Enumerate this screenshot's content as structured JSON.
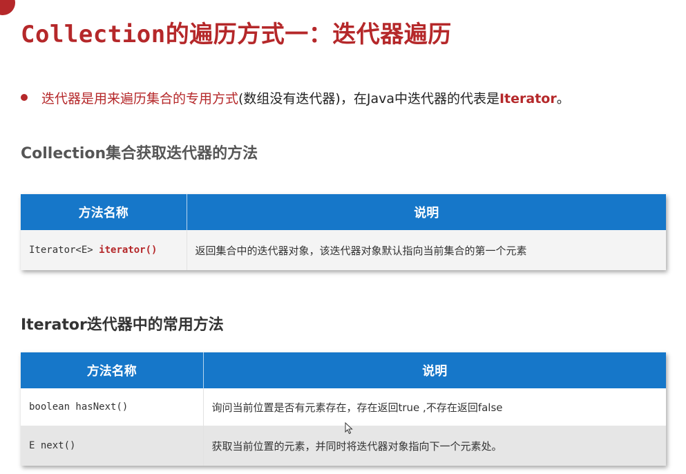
{
  "title": {
    "part1": "Collection",
    "part2": "的遍历方式一：迭代器遍历"
  },
  "bullet": {
    "red_text": "迭代器是用来遍历集合的专用方式",
    "normal_text": "(数组没有迭代器)，在Java中迭代器的代表是",
    "keyword": "Iterator",
    "end": "。"
  },
  "section1": {
    "title": "Collection集合获取迭代器的方法",
    "headers": [
      "方法名称",
      "说明"
    ],
    "rows": [
      {
        "method_type": "Iterator<E> ",
        "method_name": "iterator()",
        "desc": "返回集合中的迭代器对象，该迭代器对象默认指向当前集合的第一个元素"
      }
    ]
  },
  "section2": {
    "title": "Iterator迭代器中的常用方法",
    "headers": [
      "方法名称",
      "说明"
    ],
    "rows": [
      {
        "method": "boolean hasNext()",
        "desc": "询问当前位置是否有元素存在，存在返回true ,不存在返回false"
      },
      {
        "method": "E next()",
        "desc": "获取当前位置的元素，并同时将迭代器对象指向下一个元素处。"
      }
    ]
  },
  "colors": {
    "accent": "#b5282a",
    "header_blue": "#1677c9"
  }
}
